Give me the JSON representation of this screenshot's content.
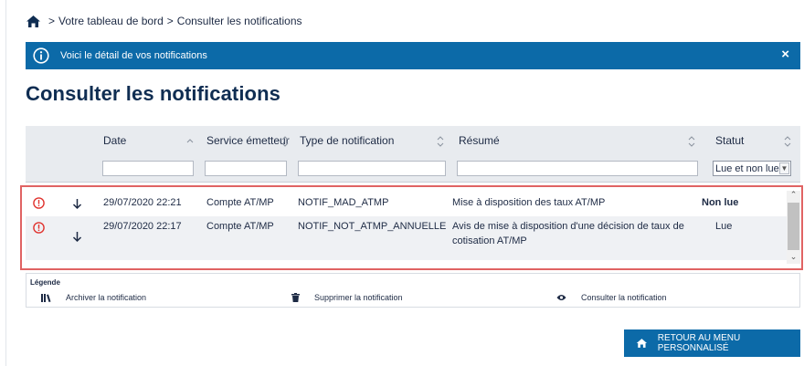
{
  "breadcrumb": {
    "items": [
      "Votre tableau de bord",
      "Consulter les notifications"
    ]
  },
  "banner": {
    "message": "Voici le détail de vos notifications",
    "close_label": "×"
  },
  "page": {
    "title": "Consulter les notifications"
  },
  "table": {
    "columns": [
      "Date",
      "Service émetteur",
      "Type de notification",
      "Résumé",
      "Statut"
    ],
    "status_filter_value": "Lue et non lue",
    "rows": [
      {
        "date": "29/07/2020 22:21",
        "service": "Compte AT/MP",
        "type": "NOTIF_MAD_ATMP",
        "summary": "Mise à disposition des taux AT/MP",
        "status": "Non lue"
      },
      {
        "date": "29/07/2020 22:17",
        "service": "Compte AT/MP",
        "type": "NOTIF_NOT_ATMP_ANNUELLE",
        "summary_line1": "Avis de mise à disposition d'une décision de taux de",
        "summary_line2": "cotisation AT/MP",
        "status": "Lue"
      }
    ]
  },
  "legend": {
    "title": "Légende",
    "archive": "Archiver la notification",
    "delete": "Supprimer la notification",
    "view": "Consulter la notification"
  },
  "footer": {
    "back_button": "RETOUR AU MENU PERSONNALISÉ"
  },
  "colors": {
    "primary_blue": "#0c6aa8",
    "title_navy": "#0f2d52",
    "alert_red": "#e0342f",
    "highlight_border": "#e06363"
  }
}
